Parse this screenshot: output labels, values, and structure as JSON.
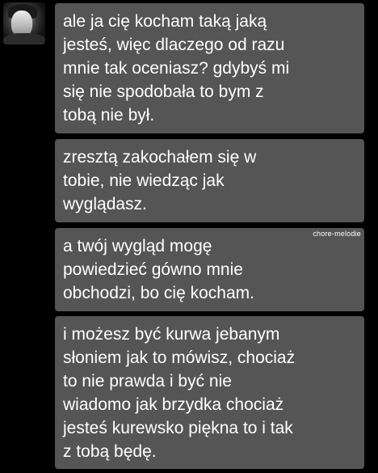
{
  "conversation": {
    "messages": [
      {
        "text": "ale ja cię kocham taką jaką\njesteś, więc dlaczego od razu\nmnie tak oceniasz? gdybyś mi\nsię nie spodobała to bym z\ntobą nie był."
      },
      {
        "text": "zresztą zakochałem się w\ntobie, nie wiedząc jak\nwyglądasz."
      },
      {
        "text": "a twój wygląd mogę\npowiedzieć gówno mnie\nobchodzi, bo cię kocham."
      },
      {
        "text": "i możesz być kurwa jebanym\nsłoniem jak to mówisz, chociaż\nto nie prawda i być nie\nwiadomo jak brzydka chociaż\njesteś kurewsko piękna to i tak\nz tobą będę."
      }
    ]
  },
  "watermark": {
    "text": "chore-melodie"
  },
  "colors": {
    "background": "#000000",
    "bubble": "#555555",
    "text": "#ffffff"
  }
}
